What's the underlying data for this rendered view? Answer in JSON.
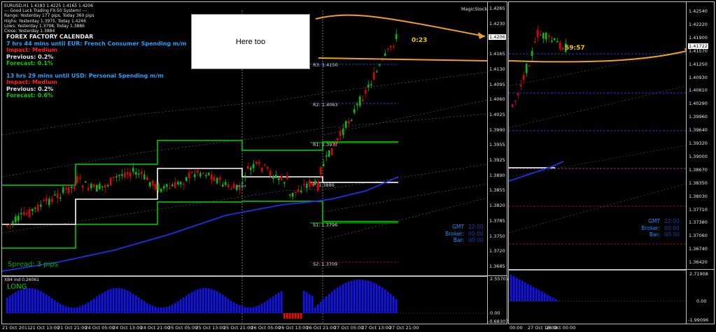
{
  "header": {
    "symbol_line": "EURUSD,H1  1.4183 1.4225 1.4165 1.4206",
    "system_line": "--- Good Luck Trading FX-50 System! ---",
    "range_line": "Range: Yesterday 177 pips, Today 360 pips",
    "highs_line": "Highs: Yesterday 1.3975, Today 1.4246",
    "lows_line": "Lows: Yesterday 1.3798, Today 1.3886",
    "close_line": "Close: Yesterday 1.3884"
  },
  "calendar": {
    "title": "FOREX FACTORY CALENDAR",
    "event1": "7 hrs 44 mins until EUR: French Consumer Spending m/m",
    "impact1": "Impact: Medium",
    "previous1": "Previous: 0.2%",
    "forecast1": "Forecast: 0.1%",
    "event2": "13 hrs 29 mins until USD: Personal Spending m/m",
    "impact2": "Impact: Medium",
    "previous2": "Previous: 0.2%",
    "forecast2": "Forecast: 0.6%"
  },
  "annotation": {
    "note": "Here too"
  },
  "magic": "MagicStock",
  "timers": {
    "left": "0:23",
    "right": "59:57"
  },
  "levels": {
    "r3": "R3: 1.4150",
    "r2": "R2: 1.4063",
    "r1": "R1: 1.3977",
    "p": "P: 1.3886",
    "s1": "S1: 1.3796",
    "s2": "S2: 1.3709",
    "start": "start"
  },
  "spread": "Spread: 3 pips",
  "left_axis": [
    "1.4265",
    "1.4230",
    "1.4195",
    "1.4165",
    "1.4130",
    "1.4095",
    "1.4060",
    "1.4025",
    "1.3990",
    "1.3955",
    "1.3925",
    "1.3890",
    "1.3855",
    "1.3820",
    "1.3785",
    "1.3750",
    "1.3720",
    "1.3685"
  ],
  "current_price_left": "1.4206",
  "right_axis": [
    "1.42540",
    "1.42220",
    "1.41900",
    "1.41570",
    "1.41250",
    "1.40930",
    "1.40610",
    "1.40290",
    "1.39960",
    "1.39640",
    "1.39320",
    "1.39000",
    "1.38670",
    "1.38350",
    "1.38030",
    "1.37710",
    "1.37380",
    "1.37060",
    "1.36740",
    "1.36420"
  ],
  "current_price_right": "1.41722",
  "gmt_table": [
    {
      "label": "GMT",
      "value": "22:00"
    },
    {
      "label": "Broker:",
      "value": "00:00"
    },
    {
      "label": "Bar:",
      "value": "00:00"
    }
  ],
  "indicator": {
    "name": "XB4 ind 0.26061",
    "signal": "LONG",
    "axis_left": [
      "2.55701",
      "0.00",
      "-0.68307"
    ],
    "axis_right": [
      "2.71908",
      "0.00",
      "-1.99096"
    ]
  },
  "x_axis_left": [
    "21 Oct 2011",
    "21 Oct 13:00",
    "21 Oct 21:00",
    "24 Oct 05:00",
    "24 Oct 13:00",
    "24 Oct 21:00",
    "25 Oct 05:00",
    "25 Oct 13:00",
    "25 Oct 21:00",
    "26 Oct 05:00",
    "26 Oct 13:00",
    "26 Oct 21:00",
    "27 Oct 05:00",
    "27 Oct 13:00",
    "27 Oct 21:00"
  ],
  "x_axis_right": [
    "00:00",
    "27 Oct 16:00",
    "28 Oct 00:00"
  ],
  "colors": {
    "bull": "#00c000",
    "bear": "#e00000",
    "pivot_green": "#00a000",
    "ma_blue": "#1f2fe8",
    "arrow": "#f0a020",
    "hist_blue": "#1010ff",
    "hist_red": "#ff0000"
  }
}
